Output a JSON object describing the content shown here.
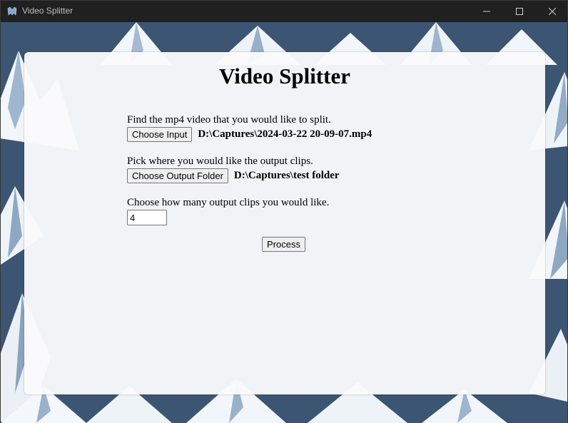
{
  "window": {
    "title": "Video Splitter",
    "controls": {
      "minimize": "minimize-icon",
      "maximize": "maximize-icon",
      "close": "close-icon"
    }
  },
  "main": {
    "heading": "Video Splitter",
    "input_section": {
      "prompt": "Find the mp4 video that you would like to split.",
      "button_label": "Choose Input",
      "selected_path": "D:\\Captures\\2024-03-22 20-09-07.mp4"
    },
    "output_section": {
      "prompt": "Pick where you would like the output clips.",
      "button_label": "Choose Output Folder",
      "selected_path": "D:\\Captures\\test folder"
    },
    "clips_section": {
      "prompt": "Choose how many output clips you would like.",
      "value": "4"
    },
    "process_button_label": "Process"
  },
  "colors": {
    "titlebar": "#202020",
    "background_sky": "#3b5573",
    "panel": "#fafafc"
  }
}
